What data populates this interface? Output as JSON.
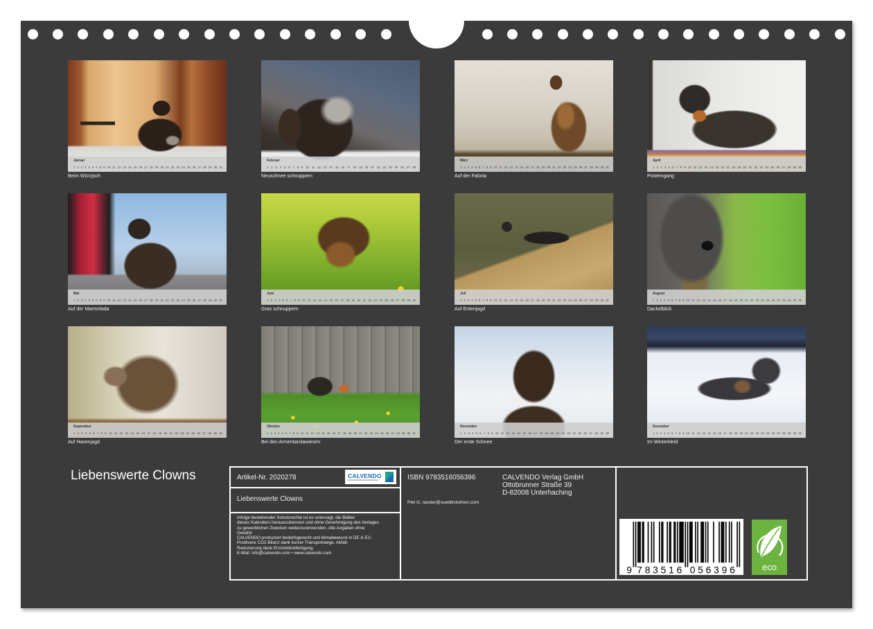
{
  "colors": {
    "sheet": "#3b3b3b",
    "eco_green": "#6cb33f",
    "logo_blue": "#1f6bb0"
  },
  "calendar": {
    "title": "Liebenswerte Clowns",
    "months": [
      {
        "name": "Januar",
        "caption": "Beim Würzjoch",
        "days": "1 2 3 4 5 6 7 8 9 10 11 12 13 14 15 16 17 18 19 20 21 22 23 24 25 26 27 28 29 30 31"
      },
      {
        "name": "Februar",
        "caption": "Neuschnee schnuppern",
        "days": "1 2 3 4 5 6 7 8 9 10 11 12 13 14 15 16 17 18 19 20 21 22 23 24 25 26 27 28"
      },
      {
        "name": "März",
        "caption": "Auf der Faloria",
        "days": "1 2 3 4 5 6 7 8 9 10 11 12 13 14 15 16 17 18 19 20 21 22 23 24 25 26 27 28 29 30 31"
      },
      {
        "name": "April",
        "caption": "Posteingang",
        "days": "1 2 3 4 5 6 7 8 9 10 11 12 13 14 15 16 17 18 19 20 21 22 23 24 25 26 27 28 29 30"
      },
      {
        "name": "Mai",
        "caption": "Auf der Marmolada",
        "days": "1 2 3 4 5 6 7 8 9 10 11 12 13 14 15 16 17 18 19 20 21 22 23 24 25 26 27 28 29 30 31"
      },
      {
        "name": "Juni",
        "caption": "Gras schnuppern",
        "days": "1 2 3 4 5 6 7 8 9 10 11 12 13 14 15 16 17 18 19 20 21 22 23 24 25 26 27 28 29 30"
      },
      {
        "name": "Juli",
        "caption": "Auf Entenjagd",
        "days": "1 2 3 4 5 6 7 8 9 10 11 12 13 14 15 16 17 18 19 20 21 22 23 24 25 26 27 28 29 30 31"
      },
      {
        "name": "August",
        "caption": "Dackelblick",
        "days": "1 2 3 4 5 6 7 8 9 10 11 12 13 14 15 16 17 18 19 20 21 22 23 24 25 26 27 28 29 30 31"
      },
      {
        "name": "September",
        "caption": "Auf Hasenjagd",
        "days": "1 2 3 4 5 6 7 8 9 10 11 12 13 14 15 16 17 18 19 20 21 22 23 24 25 26 27 28 29 30"
      },
      {
        "name": "Oktober",
        "caption": "Bei den Armentarolawiesen",
        "days": "1 2 3 4 5 6 7 8 9 10 11 12 13 14 15 16 17 18 19 20 21 22 23 24 25 26 27 28 29 30 31"
      },
      {
        "name": "November",
        "caption": "Der erste Schnee",
        "days": "1 2 3 4 5 6 7 8 9 10 11 12 13 14 15 16 17 18 19 20 21 22 23 24 25 26 27 28 29 30"
      },
      {
        "name": "Dezember",
        "caption": "Im Winterkleid",
        "days": "1 2 3 4 5 6 7 8 9 10 11 12 13 14 15 16 17 18 19 20 21 22 23 24 25 26 27 28 29 30 31"
      }
    ]
  },
  "info": {
    "article_no": "Artikel-Nr. 2020278",
    "logo": "CALVENDO",
    "title": "Liebenswerte Clowns",
    "legal": [
      "Infolge bestehender Schutzrechte ist es untersagt, die Blätter",
      "dieses Kalenders herauszutrennen und ohne Genehmigung des Verlages",
      "zu gewerblichen Zwecken weiterzuverwenden. Alle Angaben ohne",
      "Gewähr.",
      "CALVENDO produziert bedarfsgerecht und klimabewusst in DE & EU.",
      "Positivere CO2-Bilanz dank kurzer Transportwege. Abfall-",
      "Reduzierung dank Einzelstückfertigung.",
      "E-Mail: info@calvendo.com • www.calvendo.com"
    ],
    "isbn": "ISBN 9783516056396",
    "publisher": [
      "CALVENDO Verlag GmbH",
      "Ottobrunner Straße 39",
      "D-82008 Unterhaching"
    ],
    "author": "Piet G. rassler@suedtiroluhren.com",
    "barcode": {
      "lead": "9",
      "left": "783516",
      "right": "056396"
    },
    "eco_label": "eco"
  }
}
